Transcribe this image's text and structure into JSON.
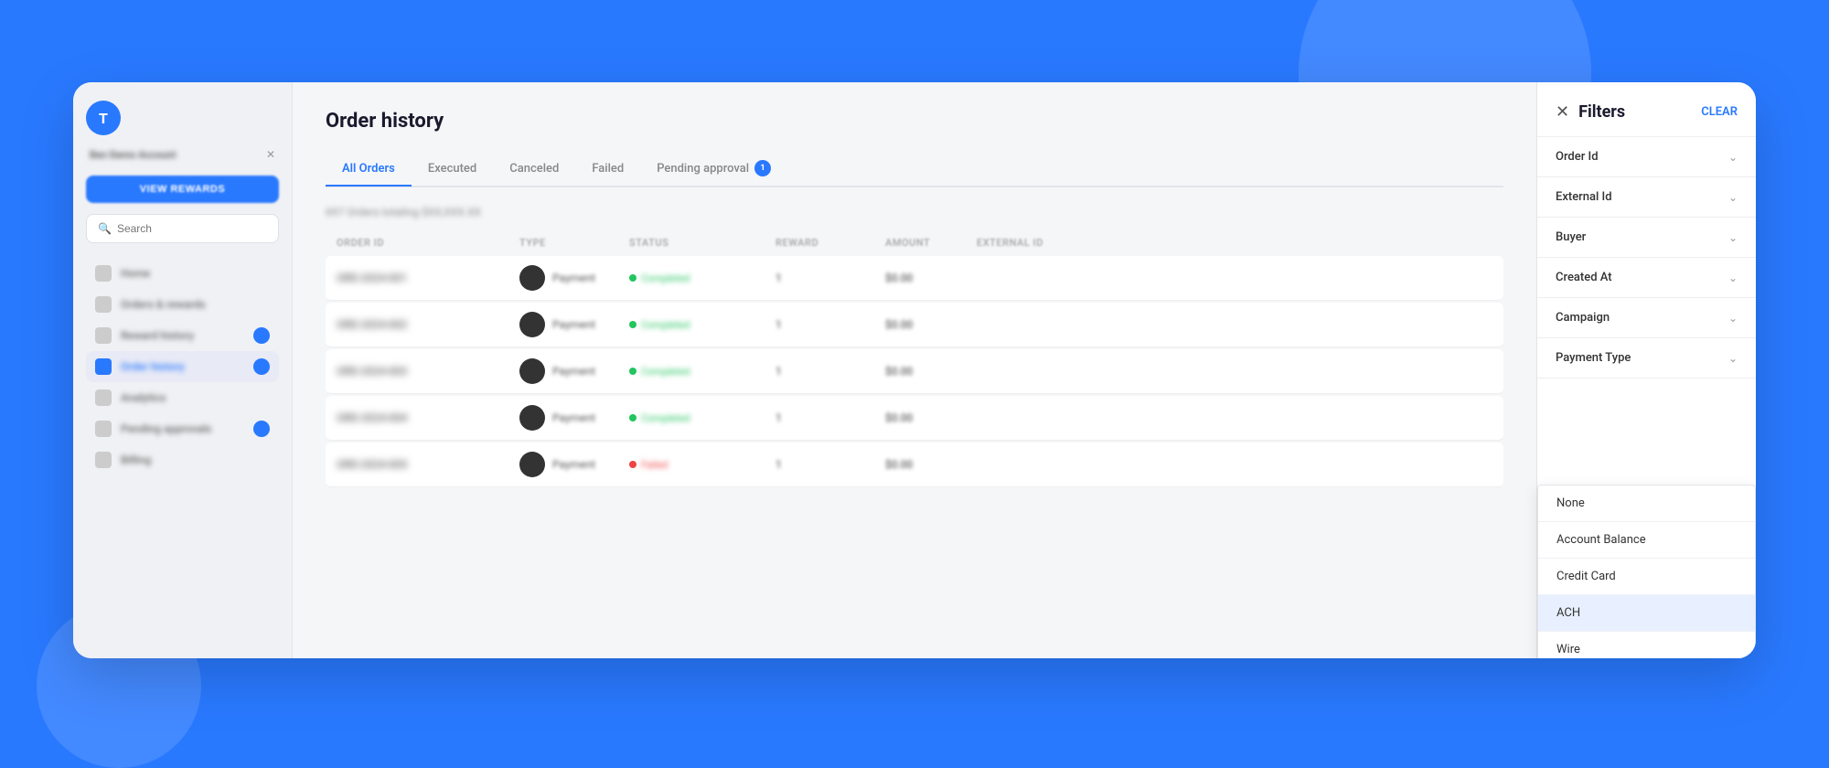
{
  "background": {
    "color": "#2979FF"
  },
  "sidebar": {
    "logo_letter": "T",
    "account_name": "Ben Demo Account",
    "cta_button": "VIEW REWARDS",
    "search_placeholder": "Search",
    "items": [
      {
        "label": "Home",
        "active": false,
        "badge": false
      },
      {
        "label": "Orders & rewards",
        "active": false,
        "badge": false
      },
      {
        "label": "Reward history",
        "active": false,
        "badge": true
      },
      {
        "label": "Order history",
        "active": true,
        "badge": true
      },
      {
        "label": "Analytics",
        "active": false,
        "badge": false
      },
      {
        "label": "Pending approvals",
        "active": false,
        "badge": true
      },
      {
        "label": "Billing",
        "active": false,
        "badge": false
      }
    ]
  },
  "main": {
    "page_title": "Order history",
    "table_subtitle": "697 Orders totaling $XX,XXX.XX",
    "tabs": [
      {
        "label": "All Orders",
        "active": true,
        "badge": null
      },
      {
        "label": "Executed",
        "active": false,
        "badge": null
      },
      {
        "label": "Canceled",
        "active": false,
        "badge": null
      },
      {
        "label": "Failed",
        "active": false,
        "badge": null
      },
      {
        "label": "Pending approval",
        "active": false,
        "badge": "1"
      }
    ],
    "table_columns": [
      "Order ID",
      "Type",
      "Status",
      "Reward",
      "Amount",
      "External ID"
    ],
    "table_rows": [
      {
        "order_id": "ORD-2024-001",
        "type": "Payment",
        "status": "completed",
        "status_label": "Completed",
        "reward": "1",
        "amount": "$0.00",
        "external_id": ""
      },
      {
        "order_id": "ORD-2024-002",
        "type": "Payment",
        "status": "completed",
        "status_label": "Completed",
        "reward": "1",
        "amount": "$0.00",
        "external_id": ""
      },
      {
        "order_id": "ORD-2024-003",
        "type": "Payment",
        "status": "completed",
        "status_label": "Completed",
        "reward": "1",
        "amount": "$0.00",
        "external_id": ""
      },
      {
        "order_id": "ORD-2024-004",
        "type": "Payment",
        "status": "completed",
        "status_label": "Completed",
        "reward": "1",
        "amount": "$0.00",
        "external_id": ""
      },
      {
        "order_id": "ORD-2024-005",
        "type": "Payment",
        "status": "failed",
        "status_label": "Failed",
        "reward": "1",
        "amount": "$0.00",
        "external_id": ""
      }
    ]
  },
  "filters": {
    "title": "Filters",
    "clear_label": "CLEAR",
    "sections": [
      {
        "label": "Order Id"
      },
      {
        "label": "External Id"
      },
      {
        "label": "Buyer"
      },
      {
        "label": "Created At"
      },
      {
        "label": "Campaign"
      },
      {
        "label": "Payment Type"
      }
    ],
    "payment_type_dropdown": {
      "open": true,
      "options": [
        {
          "label": "None",
          "selected": false
        },
        {
          "label": "Account Balance",
          "selected": false
        },
        {
          "label": "Credit Card",
          "selected": false
        },
        {
          "label": "ACH",
          "selected": true
        },
        {
          "label": "Wire",
          "selected": false
        }
      ]
    }
  }
}
